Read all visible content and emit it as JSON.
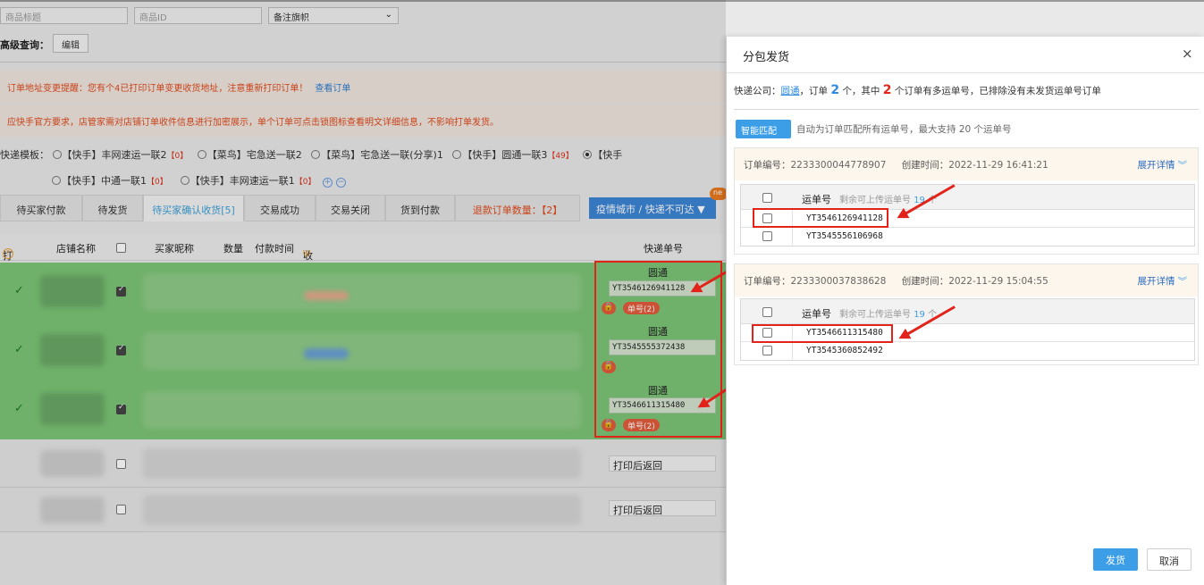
{
  "filters": {
    "title_placeholder": "商品标题",
    "id_placeholder": "商品ID",
    "flag_select": "备注旗帜",
    "advanced_label": "高级查询：",
    "edit_btn": "编辑"
  },
  "notices": {
    "address_change": "订单地址变更提醒：您有个4已打印订单变更收货地址，注意重新打印订单！",
    "view_orders": "查看订单",
    "encrypt": "应快手官方要求，店管家需对店铺订单收件信息进行加密展示，单个订单可点击锁图标查看明文详细信息，不影响打单发货。"
  },
  "templates": {
    "label": "快递模板：",
    "row1": [
      {
        "name": "【快手】丰网速运一联2",
        "count": "【0】"
      },
      {
        "name": "【菜鸟】宅急送一联2",
        "count": ""
      },
      {
        "name": "【菜鸟】宅急送一联(分享)1",
        "count": ""
      },
      {
        "name": "【快手】圆通一联3",
        "count": "【49】"
      },
      {
        "name": "【快手",
        "count": ""
      }
    ],
    "row2": [
      {
        "name": "【快手】中通一联1",
        "count": "【0】"
      },
      {
        "name": "【快手】丰网速运一联1",
        "count": "【0】"
      }
    ]
  },
  "tabs": {
    "t1": "待买家付款",
    "t2": "待发货",
    "t3": "待买家确认收货[5]",
    "t4": "交易成功",
    "t5": "交易关闭",
    "t6": "货到付款",
    "t7": "退款订单数量：【2】",
    "city": "疫情城市 / 快递不可达 ▼",
    "new_badge": "ne"
  },
  "table_header": {
    "print": "打印",
    "shop": "店铺名称",
    "buyer": "买家昵称",
    "qty": "数量",
    "paytime": "付款时间",
    "receiver": "收件人信息",
    "express": "快递单号"
  },
  "rows": [
    {
      "express": "圆通",
      "waybill": "YT3546126941128",
      "tag": "单号(2)"
    },
    {
      "express": "圆通",
      "waybill": "YT3545555372438",
      "tag": ""
    },
    {
      "express": "圆通",
      "waybill": "YT3546611315480",
      "tag": "单号(2)"
    },
    {
      "express": "",
      "waybill": "打印后返回",
      "tag": ""
    },
    {
      "express": "",
      "waybill": "打印后返回",
      "tag": ""
    }
  ],
  "modal": {
    "title": "分包发货",
    "close": "×",
    "info_prefix": "快递公司：",
    "courier": "圆通",
    "info_mid1": "，订单",
    "order_count": "2",
    "info_mid2": "个，其中",
    "multi_count": "2",
    "info_suffix": "个订单有多运单号，已排除没有未发货运单号订单",
    "smart_btn": "智能匹配",
    "smart_desc": "自动为订单匹配所有运单号，最大支持 20 个运单号",
    "orders": [
      {
        "order_label": "订单编号：",
        "order_no": "2233300044778907",
        "created_label": "创建时间：",
        "created": "2022-11-29 16:41:21",
        "expand": "展开详情",
        "col_waybill": "运单号",
        "remaining_prefix": "剩余可上传运单号",
        "remaining": "19",
        "remaining_suffix": "个",
        "waybills": [
          "YT3546126941128",
          "YT3545556106968"
        ]
      },
      {
        "order_label": "订单编号：",
        "order_no": "2233300037838628",
        "created_label": "创建时间：",
        "created": "2022-11-29 15:04:55",
        "expand": "展开详情",
        "col_waybill": "运单号",
        "remaining_prefix": "剩余可上传运单号",
        "remaining": "19",
        "remaining_suffix": "个",
        "waybills": [
          "YT3546611315480",
          "YT3545360852492"
        ]
      }
    ],
    "send_btn": "发货",
    "cancel_btn": "取消"
  },
  "colors": {
    "accent": "#3d9ee8",
    "alert": "#e2231a",
    "row_green": "#7cc576"
  }
}
